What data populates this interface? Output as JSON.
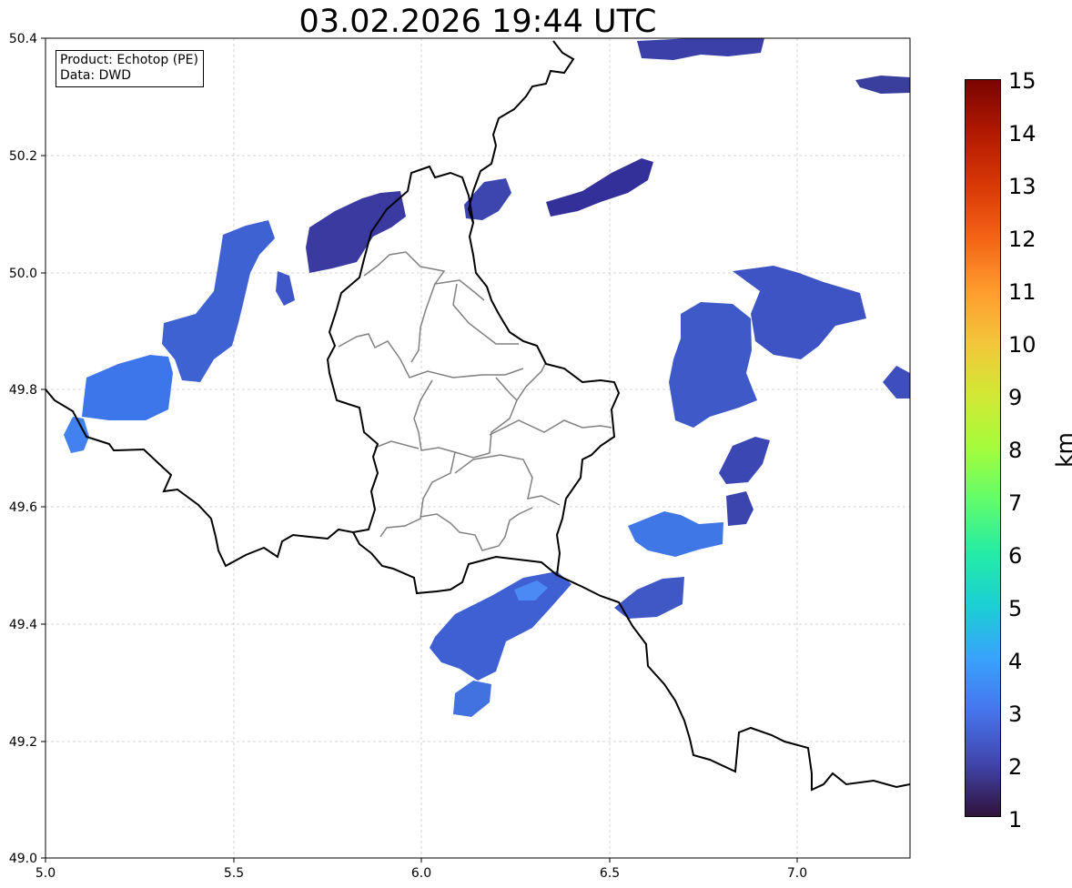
{
  "title": "03.02.2026 19:44 UTC",
  "info": {
    "product": "Product: Echotop (PE)",
    "source": "Data: DWD"
  },
  "map": {
    "lon_range": [
      5.0,
      7.3
    ],
    "lat_range": [
      49.0,
      50.4
    ],
    "x_ticks": [
      "5.0",
      "5.5",
      "6.0",
      "6.5",
      "7.0"
    ],
    "y_ticks": [
      "49.0",
      "49.2",
      "49.4",
      "49.6",
      "49.8",
      "50.0",
      "50.2",
      "50.4"
    ],
    "grid": true,
    "colors": {
      "country_border": "#000000",
      "canton_border": "#808080",
      "grid": "#c8c8c8"
    }
  },
  "colorbar": {
    "unit": "km",
    "min": 1,
    "max": 15,
    "colormap": "turbo",
    "labels": [
      "15",
      "14",
      "13",
      "12",
      "11",
      "10",
      "9",
      "8",
      "7",
      "6",
      "5",
      "4",
      "3",
      "2",
      "1"
    ]
  }
}
